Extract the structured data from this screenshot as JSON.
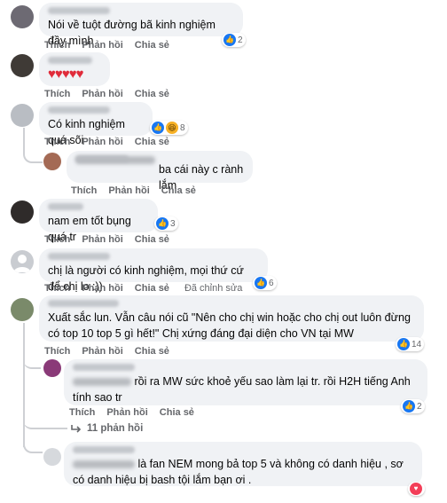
{
  "labels": {
    "like": "Thích",
    "reply": "Phản hồi",
    "share": "Chia sẻ",
    "edited": "Đã chỉnh sửa"
  },
  "comments": [
    {
      "text": "Nói về tuột đường bã kinh nghiệm đầy mình",
      "reaction_count": "2"
    },
    {
      "text": "♥♥♥♥♥",
      "reaction_count": ""
    },
    {
      "text": "Có kinh nghiệm quá sõi",
      "reaction_count": "8"
    },
    {
      "text": "ba cái này c rành lắm",
      "reaction_count": ""
    },
    {
      "text": "nam em tốt bụng quá tr",
      "reaction_count": "3"
    },
    {
      "text": "chị là người có kinh nghiệm, mọi thứ cứ để chị lo :))",
      "reaction_count": "6"
    },
    {
      "text": "Xuất sắc lun. Vẫn câu nói cũ \"Nên cho chị win hoặc cho chị out luôn đừng có top 10 top 5 gì hết!\" Chị xứng đáng đại diện cho VN tại MW",
      "reaction_count": "14"
    },
    {
      "text": "rồi ra MW sức khoẻ yếu sao làm lại tr. rồi H2H tiếng Anh tính sao tr",
      "reaction_count": "2"
    },
    {
      "text": "là fan NEM mong bả top 5 và không có danh hiệu , sơ có danh hiệu bị bash tội lắm bạn ơi .",
      "reaction_count": ""
    }
  ],
  "more_replies": "11 phản hồi",
  "colors": {
    "like": "#1877f2",
    "love": "#f33e58",
    "haha": "#f7b125",
    "bubble": "#f0f2f5",
    "meta": "#65676b"
  }
}
